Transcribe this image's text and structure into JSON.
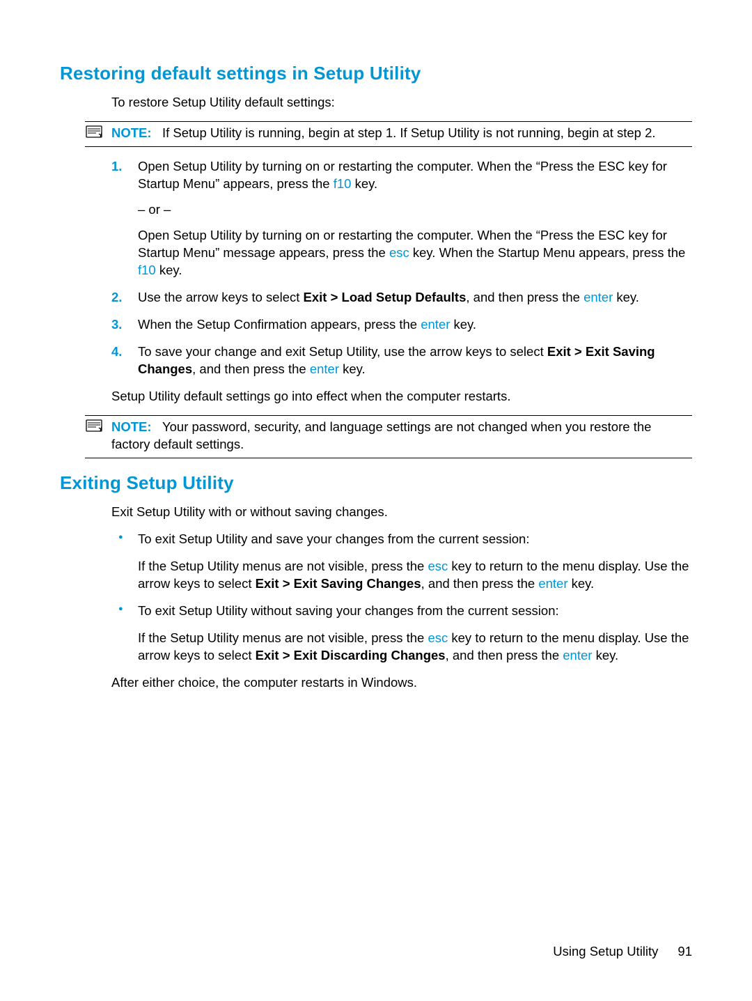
{
  "section1": {
    "heading": "Restoring default settings in Setup Utility",
    "intro": "To restore Setup Utility default settings:",
    "note1": {
      "label": "NOTE:",
      "text": "If Setup Utility is running, begin at step 1. If Setup Utility is not running, begin at step 2."
    },
    "step1_a": "Open Setup Utility by turning on or restarting the computer. When the “Press the ESC key for Startup Menu” appears, press the ",
    "step1_key1": "f10",
    "step1_b": " key.",
    "or": "– or –",
    "step1_c": "Open Setup Utility by turning on or restarting the computer. When the “Press the ESC key for Startup Menu” message appears, press the ",
    "step1_key2": "esc",
    "step1_d": " key. When the Startup Menu appears, press the ",
    "step1_key3": "f10",
    "step1_e": " key.",
    "step2_a": "Use the arrow keys to select ",
    "step2_bold": "Exit > Load Setup Defaults",
    "step2_b": ", and then press the ",
    "step2_key": "enter",
    "step2_c": " key.",
    "step3_a": "When the Setup Confirmation appears, press the ",
    "step3_key": "enter",
    "step3_b": " key.",
    "step4_a": "To save your change and exit Setup Utility, use the arrow keys to select ",
    "step4_bold": "Exit > Exit Saving Changes",
    "step4_b": ", and then press the ",
    "step4_key": "enter",
    "step4_c": " key.",
    "after_steps": "Setup Utility default settings go into effect when the computer restarts.",
    "note2": {
      "label": "NOTE:",
      "text": "Your password, security, and language settings are not changed when you restore the factory default settings."
    }
  },
  "section2": {
    "heading": "Exiting Setup Utility",
    "intro": "Exit Setup Utility with or without saving changes.",
    "b1_lead": "To exit Setup Utility and save your changes from the current session:",
    "b1_a": "If the Setup Utility menus are not visible, press the ",
    "b1_key1": "esc",
    "b1_b": " key to return to the menu display. Use the arrow keys to select ",
    "b1_bold": "Exit > Exit Saving Changes",
    "b1_c": ", and then press the ",
    "b1_key2": "enter",
    "b1_d": " key.",
    "b2_lead": "To exit Setup Utility without saving your changes from the current session:",
    "b2_a": "If the Setup Utility menus are not visible, press the ",
    "b2_key1": "esc",
    "b2_b": " key to return to the menu display. Use the arrow keys to select ",
    "b2_bold": "Exit > Exit Discarding Changes",
    "b2_c": ", and then press the ",
    "b2_key2": "enter",
    "b2_d": " key.",
    "after": "After either choice, the computer restarts in Windows."
  },
  "footer": {
    "label": "Using Setup Utility",
    "page": "91"
  },
  "nums": {
    "n1": "1.",
    "n2": "2.",
    "n3": "3.",
    "n4": "4."
  }
}
